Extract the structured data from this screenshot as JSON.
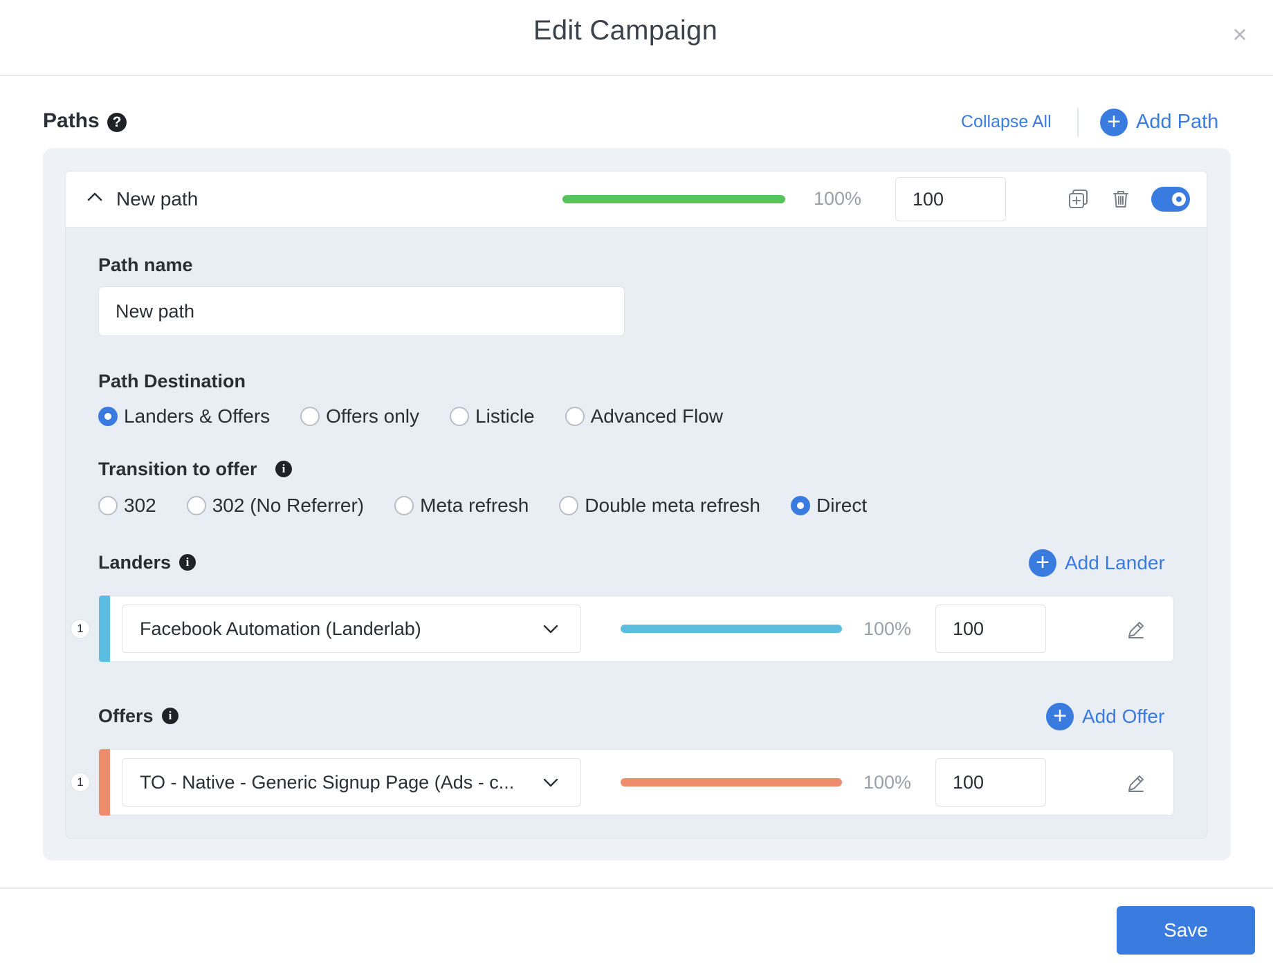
{
  "modal": {
    "title": "Edit Campaign",
    "close_glyph": "×"
  },
  "paths_section": {
    "title": "Paths",
    "help_glyph": "?",
    "collapse_all_label": "Collapse All",
    "add_path_label": "Add Path"
  },
  "path": {
    "name": "New path",
    "weight_percent": "100%",
    "weight_value": "100",
    "weight_fraction": 1.0,
    "enabled": true,
    "name_label": "Path name",
    "name_input_value": "New path",
    "destination_label": "Path Destination",
    "destination_options": [
      "Landers & Offers",
      "Offers only",
      "Listicle",
      "Advanced Flow"
    ],
    "destination_selected": "Landers & Offers",
    "transition_label": "Transition to offer",
    "transition_options": [
      "302",
      "302 (No Referrer)",
      "Meta refresh",
      "Double meta refresh",
      "Direct"
    ],
    "transition_selected": "Direct"
  },
  "landers": {
    "label": "Landers",
    "add_label": "Add Lander",
    "items": [
      {
        "index": "1",
        "name": "Facebook Automation (Landerlab)",
        "percent": "100%",
        "weight": "100",
        "fraction": 1.0,
        "color": "#5bbddf"
      }
    ]
  },
  "offers": {
    "label": "Offers",
    "add_label": "Add Offer",
    "items": [
      {
        "index": "1",
        "name": "TO - Native - Generic Signup Page (Ads - c...",
        "percent": "100%",
        "weight": "100",
        "fraction": 1.0,
        "color": "#ef8c6d"
      }
    ]
  },
  "footer": {
    "save_label": "Save"
  },
  "colors": {
    "accent": "#3a7be0",
    "path_bar": "#57c35b",
    "lander_bar": "#5bbddf",
    "offer_bar": "#ef8c6d"
  }
}
